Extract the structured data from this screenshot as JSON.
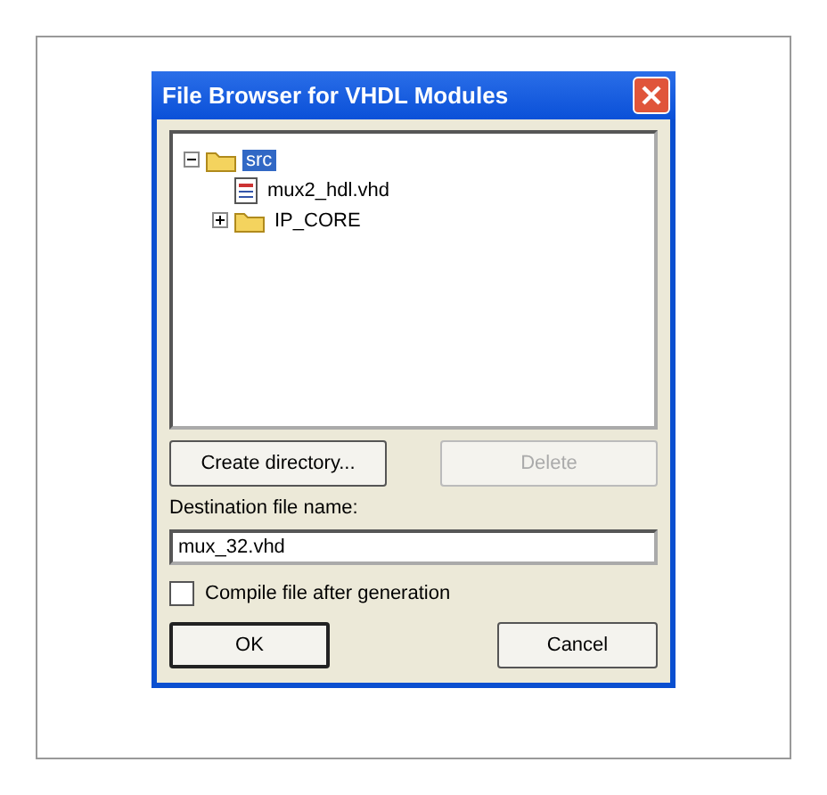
{
  "window": {
    "title": "File Browser for VHDL Modules"
  },
  "tree": [
    {
      "label": "src",
      "kind": "folder",
      "expanded": true,
      "selected": true,
      "children": [
        {
          "label": "mux2_hdl.vhd",
          "kind": "file",
          "selected": false
        },
        {
          "label": "IP_CORE",
          "kind": "folder",
          "expanded": false,
          "selected": false
        }
      ]
    }
  ],
  "buttons": [
    {
      "label": "Create directory...",
      "disabled": false
    },
    {
      "label": "Delete",
      "disabled": true
    }
  ],
  "destination": {
    "label": "Destination file name:",
    "value": "mux_32.vhd"
  },
  "compile": {
    "label": "Compile file after generation",
    "checked": false
  },
  "footer": [
    {
      "label": "OK",
      "default": true
    },
    {
      "label": "Cancel",
      "default": false
    }
  ]
}
